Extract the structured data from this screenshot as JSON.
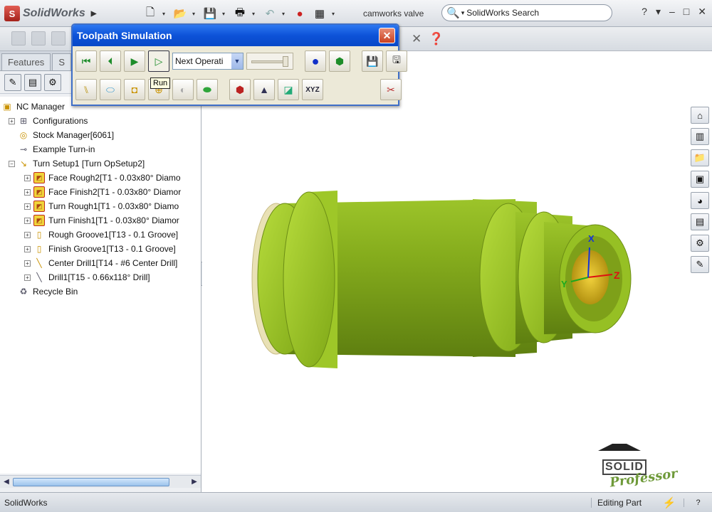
{
  "app": {
    "name": "SolidWorks",
    "document_title": "camworks valve"
  },
  "search": {
    "placeholder": "SolidWorks Search"
  },
  "window_controls": [
    "?",
    "▾",
    "–",
    "□",
    "✕"
  ],
  "tabs": [
    {
      "label": "Features"
    },
    {
      "label": "S"
    }
  ],
  "tree": {
    "root": "NC Manager",
    "items": [
      {
        "label": "Configurations",
        "level": 1,
        "expander": true,
        "icon": "configurations-icon"
      },
      {
        "label": "Stock Manager[6061]",
        "level": 1,
        "expander": false,
        "icon": "stock-manager-icon"
      },
      {
        "label": "Example Turn-in",
        "level": 1,
        "expander": false,
        "icon": "machine-icon"
      },
      {
        "label": "Turn Setup1 [Turn OpSetup2]",
        "level": 1,
        "expander": true,
        "icon": "turn-setup-icon"
      },
      {
        "label": "Face Rough2[T1 - 0.03x80° Diamo",
        "level": 2,
        "expander": true,
        "icon": "operation-icon"
      },
      {
        "label": "Face Finish2[T1 - 0.03x80° Diamor",
        "level": 2,
        "expander": true,
        "icon": "operation-icon"
      },
      {
        "label": "Turn Rough1[T1 - 0.03x80° Diamo",
        "level": 2,
        "expander": true,
        "icon": "operation-icon"
      },
      {
        "label": "Turn Finish1[T1 - 0.03x80° Diamor",
        "level": 2,
        "expander": true,
        "icon": "operation-icon"
      },
      {
        "label": "Rough Groove1[T13 - 0.1 Groove]",
        "level": 2,
        "expander": true,
        "icon": "groove-icon"
      },
      {
        "label": "Finish Groove1[T13 - 0.1 Groove]",
        "level": 2,
        "expander": true,
        "icon": "groove-icon"
      },
      {
        "label": "Center Drill1[T14 - #6 Center Drill]",
        "level": 2,
        "expander": true,
        "icon": "center-drill-icon"
      },
      {
        "label": "Drill1[T15 - 0.66x118° Drill]",
        "level": 2,
        "expander": true,
        "icon": "drill-icon"
      },
      {
        "label": "Recycle Bin",
        "level": 1,
        "expander": false,
        "icon": "recycle-bin-icon"
      }
    ]
  },
  "dialog": {
    "title": "Toolpath Simulation",
    "step_mode": "Next Operati",
    "tooltip": "Run",
    "xyz_label": "XYZ"
  },
  "axes": {
    "x": "X",
    "y": "Y",
    "z": "Z"
  },
  "brand": {
    "line1": "SOLID",
    "line2": "Professor"
  },
  "status": {
    "left": "SolidWorks",
    "mode": "Editing Part"
  },
  "colors": {
    "part_green": "#7fa817",
    "dialog_title": "#0d52d8",
    "close_red": "#c94020"
  }
}
